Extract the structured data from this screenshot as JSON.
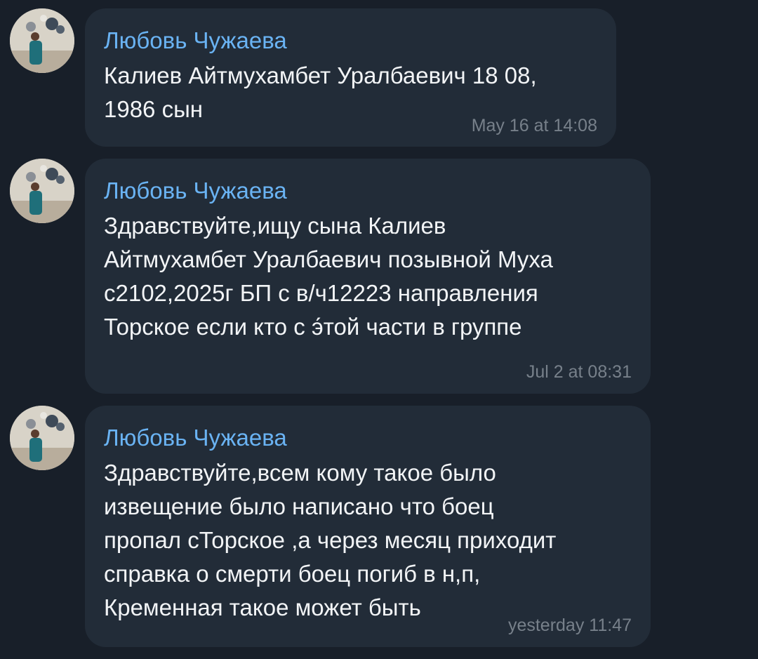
{
  "messages": [
    {
      "sender": "Любовь Чужаева",
      "lines": [
        "Калиев Айтмухамбет Уралбаевич 18 08,",
        "1986 сын"
      ],
      "time": "May 16 at 14:08",
      "avatar_icon": "user-photo-avatar"
    },
    {
      "sender": "Любовь Чужаева",
      "lines": [
        "Здравствуйте,ищу сына Калиев",
        "Айтмухамбет Уралбаевич позывной Муха",
        "с2102,2025г БП с в/ч12223 направления",
        "Торское если кто с э́той части в группе"
      ],
      "time": "Jul 2 at 08:31",
      "avatar_icon": "user-photo-avatar"
    },
    {
      "sender": "Любовь Чужаева",
      "lines": [
        "Здравствуйте,всем кому такое было",
        "извещение было написано что боец",
        "пропал сТорское ,а через месяц приходит",
        "справка о смерти боец погиб в н,п,",
        "Кременная такое может быть"
      ],
      "time": "yesterday 11:47",
      "avatar_icon": "user-photo-avatar"
    }
  ],
  "colors": {
    "background": "#181f29",
    "bubble": "#222c38",
    "sender": "#6ab3f3",
    "text": "#f2f4f6",
    "time": "#77808a"
  }
}
